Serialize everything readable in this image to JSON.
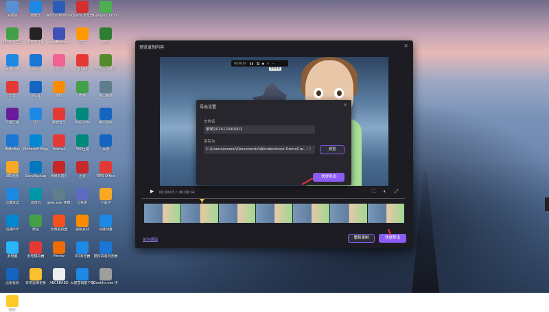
{
  "desktop": {
    "icons": [
      {
        "label": "回收站",
        "color": "#5a8fd6"
      },
      {
        "label": "酷家乐",
        "color": "#1e88e5"
      },
      {
        "label": "Adobe Photosho...",
        "color": "#2b5db8"
      },
      {
        "label": "Opera 浏览器",
        "color": "#d32f2f"
      },
      {
        "label": "Google Chrome",
        "color": "#4caf50"
      },
      {
        "label": "360安全卫士",
        "color": "#43a047"
      },
      {
        "label": "剪映专业版",
        "color": "#222222"
      },
      {
        "label": "elecBoom...",
        "color": "#3f51b5"
      },
      {
        "label": "文件",
        "color": "#ff9800"
      },
      {
        "label": "游戏",
        "color": "#2e7d32"
      },
      {
        "label": "百度网盘",
        "color": "#1e88e5"
      },
      {
        "label": "翻译",
        "color": "#1976d2"
      },
      {
        "label": "画图",
        "color": "#f06292"
      },
      {
        "label": "爱剪辑",
        "color": "#e53935"
      },
      {
        "label": "植物大战僵尸",
        "color": "#558b2f"
      },
      {
        "label": "迅雷",
        "color": "#e53935"
      },
      {
        "label": "Word",
        "color": "#1565c0"
      },
      {
        "label": "WPS",
        "color": "#fb8c00"
      },
      {
        "label": "微信",
        "color": "#43a047"
      },
      {
        "label": "金山毒霸",
        "color": "#607d8b"
      },
      {
        "label": "万能压缩",
        "color": "#6a1b9a"
      },
      {
        "label": "QQ",
        "color": "#1e88e5"
      },
      {
        "label": "酷狗音乐",
        "color": "#e53935"
      },
      {
        "label": "WeGame",
        "color": "#00897b"
      },
      {
        "label": "腾讯视频",
        "color": "#1565c0"
      },
      {
        "label": "滴滴eBay",
        "color": "#1976d2"
      },
      {
        "label": "Microsoft Edge",
        "color": "#0288d1"
      },
      {
        "label": "Foxmail",
        "color": "#e53935"
      },
      {
        "label": "360压缩",
        "color": "#00897b"
      },
      {
        "label": "百度",
        "color": "#1565c0"
      },
      {
        "label": "360画报",
        "color": "#f9a825"
      },
      {
        "label": "EasyBackup",
        "color": "#0277bd"
      },
      {
        "label": "网易云音乐",
        "color": "#c62828"
      },
      {
        "label": "迅雷",
        "color": "#c62828"
      },
      {
        "label": "WPS Office",
        "color": "#e53935"
      },
      {
        "label": "迅捷录屏",
        "color": "#1e88e5"
      },
      {
        "label": "录音机",
        "color": "#0097a7"
      },
      {
        "label": "geek.exe 快捷方式",
        "color": "#607d8b"
      },
      {
        "label": "Q系统",
        "color": "#5c6bc0"
      },
      {
        "label": "小黑子",
        "color": "#f9a825"
      },
      {
        "label": "迅捷PDF",
        "color": "#0288d1"
      },
      {
        "label": "微信",
        "color": "#43a047"
      },
      {
        "label": "雷电模拟器",
        "color": "#f4511e"
      },
      {
        "label": "视频素材",
        "color": "#fb8c00"
      },
      {
        "label": "百度网盘",
        "color": "#1e88e5"
      },
      {
        "label": "此电脑",
        "color": "#29b6f6"
      },
      {
        "label": "雷电模拟器",
        "color": "#e53935"
      },
      {
        "label": "Firefox",
        "color": "#ef6c00"
      },
      {
        "label": "QQ浏览器",
        "color": "#1e88e5"
      },
      {
        "label": "搜狗高速浏览器",
        "color": "#1976d2"
      },
      {
        "label": "迅雷看看",
        "color": "#1565c0"
      },
      {
        "label": "日常运维更新",
        "color": "#fbc02d"
      },
      {
        "label": "ABCEBABD",
        "color": "#eeeeee"
      },
      {
        "label": "百度营销客户端",
        "color": "#1e88e5"
      },
      {
        "label": "GeekIcr.exe 快捷方式",
        "color": "#9e9e9e"
      },
      {
        "label": "备忘",
        "color": "#ffca28"
      }
    ]
  },
  "dialog": {
    "title": "预览录制内容",
    "close": "×",
    "recording_bar": {
      "time": "00:00:03",
      "tooltip": "暂停录制"
    },
    "export_settings": {
      "title": "导出设置",
      "close": "×",
      "filename_label": "文件名",
      "filename_value": "录制2024120400​01",
      "saveas_label": "另存为",
      "path_value": "C:\\Users\\renwei\\Documents\\Wondershare DemoCre...",
      "browse_button": "浏览",
      "quick_export_button": "快速导出"
    },
    "player": {
      "current_time": "00:00:03",
      "separator": "/",
      "total_time": "00:00:14"
    },
    "edit_link": "前往编辑",
    "re_record_button": "重新录制",
    "quick_export_button": "快速导出"
  }
}
